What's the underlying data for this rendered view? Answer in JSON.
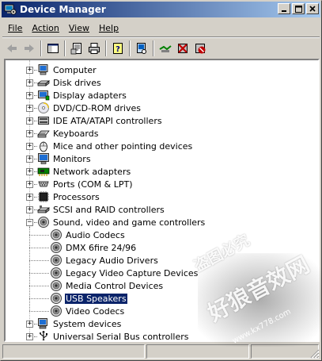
{
  "window": {
    "title": "Device Manager"
  },
  "title_buttons": {
    "minimize": "_",
    "maximize": "□",
    "close": "×"
  },
  "menu": [
    {
      "label": "File"
    },
    {
      "label": "Action"
    },
    {
      "label": "View"
    },
    {
      "label": "Help"
    }
  ],
  "toolbar": [
    {
      "icon": "back-arrow-icon"
    },
    {
      "icon": "forward-arrow-icon"
    },
    {
      "icon": "show-hide-console-tree-icon"
    },
    {
      "icon": "properties-icon"
    },
    {
      "icon": "print-icon"
    },
    {
      "icon": "help-icon"
    },
    {
      "icon": "scan-hardware-icon"
    },
    {
      "icon": "update-driver-icon"
    },
    {
      "icon": "disable-device-icon"
    },
    {
      "icon": "uninstall-device-icon"
    }
  ],
  "tree": {
    "categories": [
      {
        "label": "Computer",
        "icon": "computer-icon",
        "expanded": false
      },
      {
        "label": "Disk drives",
        "icon": "disk-drive-icon",
        "expanded": false
      },
      {
        "label": "Display adapters",
        "icon": "display-adapter-icon",
        "expanded": false
      },
      {
        "label": "DVD/CD-ROM drives",
        "icon": "cdrom-icon",
        "expanded": false
      },
      {
        "label": "IDE ATA/ATAPI controllers",
        "icon": "ide-controller-icon",
        "expanded": false
      },
      {
        "label": "Keyboards",
        "icon": "keyboard-icon",
        "expanded": false
      },
      {
        "label": "Mice and other pointing devices",
        "icon": "mouse-icon",
        "expanded": false
      },
      {
        "label": "Monitors",
        "icon": "monitor-icon",
        "expanded": false
      },
      {
        "label": "Network adapters",
        "icon": "network-adapter-icon",
        "expanded": false
      },
      {
        "label": "Ports (COM & LPT)",
        "icon": "port-icon",
        "expanded": false
      },
      {
        "label": "Processors",
        "icon": "processor-icon",
        "expanded": false
      },
      {
        "label": "SCSI and RAID controllers",
        "icon": "scsi-controller-icon",
        "expanded": false
      },
      {
        "label": "Sound, video and game controllers",
        "icon": "speaker-icon",
        "expanded": true,
        "children": [
          {
            "label": "Audio Codecs",
            "icon": "speaker-icon",
            "selected": false
          },
          {
            "label": "DMX 6fire 24/96",
            "icon": "speaker-icon",
            "selected": false
          },
          {
            "label": "Legacy Audio Drivers",
            "icon": "speaker-icon",
            "selected": false
          },
          {
            "label": "Legacy Video Capture Devices",
            "icon": "speaker-icon",
            "selected": false
          },
          {
            "label": "Media Control Devices",
            "icon": "speaker-icon",
            "selected": false
          },
          {
            "label": "USB Speakers",
            "icon": "speaker-icon",
            "selected": true
          },
          {
            "label": "Video Codecs",
            "icon": "speaker-icon",
            "selected": false
          }
        ]
      },
      {
        "label": "System devices",
        "icon": "system-device-icon",
        "expanded": false
      },
      {
        "label": "Universal Serial Bus controllers",
        "icon": "usb-icon",
        "expanded": false
      }
    ]
  },
  "watermark": {
    "line1": "盗图必究",
    "line2": "好狼音效网",
    "line3": "www.kx778.com"
  },
  "colors": {
    "titlebar_start": "#0a246a",
    "titlebar_end": "#a6caf0",
    "selection": "#0a246a",
    "face": "#d4d0c8"
  }
}
